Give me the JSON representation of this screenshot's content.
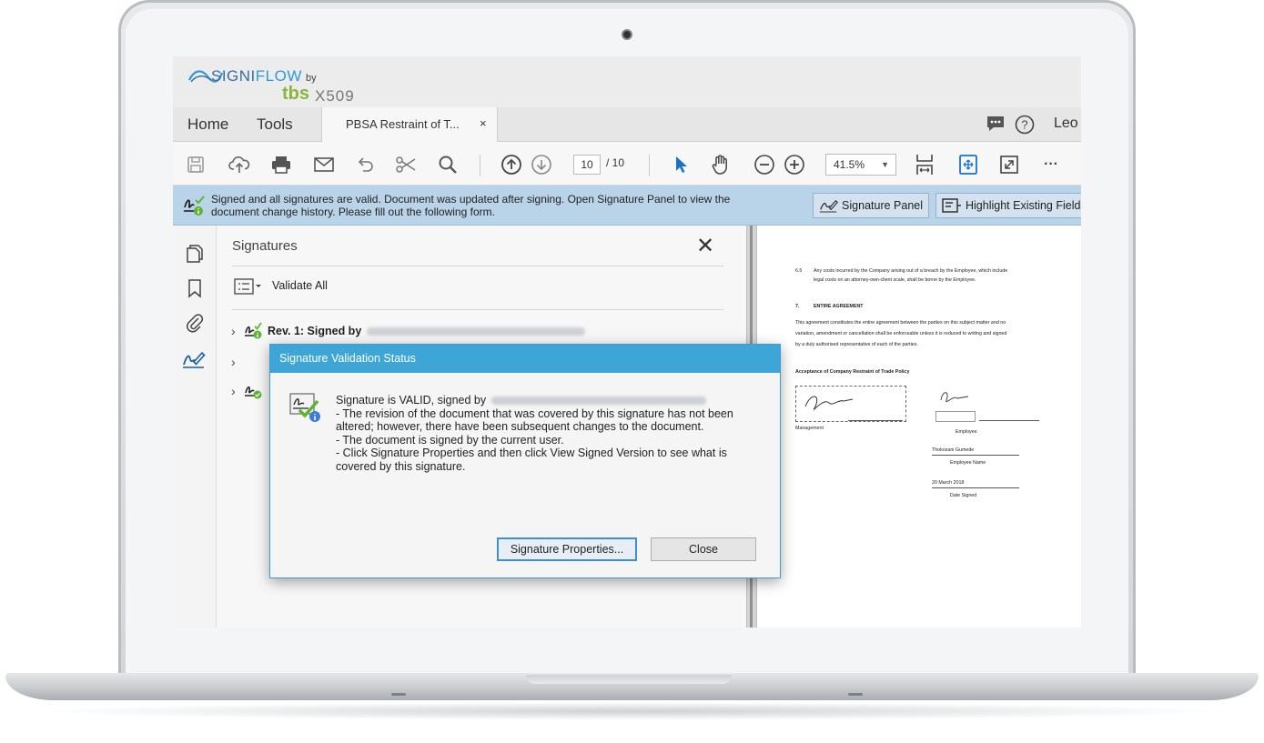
{
  "brand": {
    "logo_sign": "SIGNI",
    "logo_flow": "FLOW",
    "logo_by": "by",
    "logo_tbs": "tbs",
    "logo_x509": "X509"
  },
  "tabs": {
    "home": "Home",
    "tools": "Tools",
    "document": "PBSA Restraint of T...",
    "close_glyph": "×",
    "user_partial": "Leo"
  },
  "toolbar": {
    "page_current": "10",
    "page_total": "/ 10",
    "zoom": "41.5%",
    "zoom_caret": "▼",
    "more": "···"
  },
  "infobar": {
    "message_line1": "Signed and all signatures are valid. Document was updated after signing. Open Signature Panel to view the",
    "message_line2": "document change history.  Please fill out the following form.",
    "signature_panel_button": "Signature Panel",
    "highlight_button": "Highlight Existing Field"
  },
  "signatures_panel": {
    "title": "Signatures",
    "close_glyph": "✕",
    "validate_all": "Validate All",
    "rows": [
      {
        "label": "Rev. 1: Signed by"
      },
      {
        "label": ""
      },
      {
        "label": ""
      }
    ]
  },
  "dialog": {
    "title": "Signature Validation Status",
    "lines": [
      "Signature is VALID, signed by",
      "- The revision of the document that was covered by this signature has not been altered; however, there have been subsequent changes to the document.",
      "- The document is signed by the current user.",
      "- Click Signature Properties and then click View Signed Version to see what is covered by this signature."
    ],
    "properties_button": "Signature Properties...",
    "close_button": "Close"
  },
  "document_page": {
    "clause_65_num": "6.5",
    "clause_65_a": "Any costs incurred by the Company arising out of a breach by the Employee, which include",
    "clause_65_b": "legal costs on an attorney-own-client scale, shall be borne by the Employee.",
    "clause_7_num": "7.",
    "clause_7_title": "ENTIRE AGREEMENT",
    "clause_7_a": "This agreement constitutes the entire agreement between the parties on this subject matter and no",
    "clause_7_b": "variation, amendment or cancellation shall be enforceable unless it is reduced to writing and signed",
    "clause_7_c": "by a duly authorised representative of each of the parties.",
    "acceptance": "Acceptance of Company Restraint of Trade Policy",
    "management": "Management",
    "employee": "Employee",
    "employee_name_value": "Thokozani Gumede",
    "employee_name": "Employee Name",
    "date_value": "20 March 2018",
    "date_signed": "Date Signed"
  },
  "colors": {
    "infobar": "#b9d4e8",
    "dialog_title": "#3ea6d6",
    "accent_blue": "#1a73c9",
    "valid_green": "#5cb531"
  }
}
